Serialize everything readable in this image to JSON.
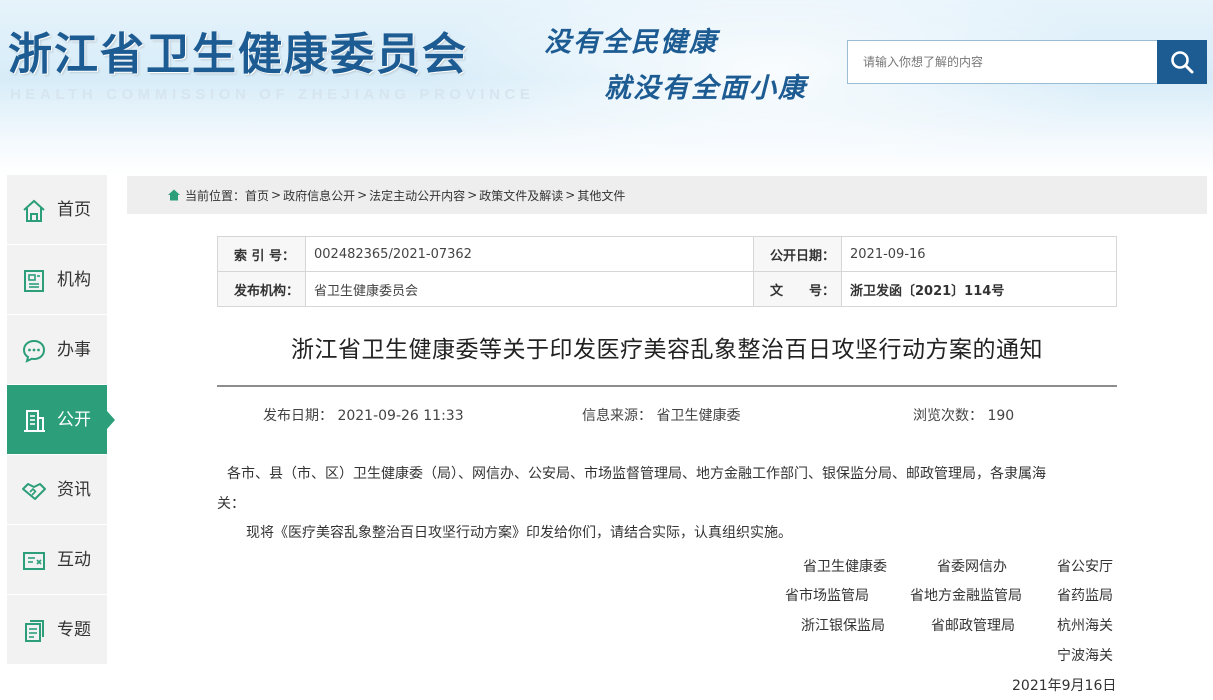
{
  "header": {
    "logo_cn": "浙江省卫生健康委员会",
    "logo_en": "HEALTH COMMISSION OF ZHEJIANG PROVINCE",
    "slogan_line1": "没有全民健康",
    "slogan_line2": "就没有全面小康",
    "search": {
      "placeholder": "请输入你想了解的内容",
      "button_icon": "search-icon"
    },
    "brand_color": "#1d5b93"
  },
  "sidebar": {
    "active_color": "#2c9f7a",
    "items": [
      {
        "label": "首页",
        "icon": "home-icon",
        "active": false
      },
      {
        "label": "机构",
        "icon": "building-card-icon",
        "active": false
      },
      {
        "label": "办事",
        "icon": "chat-dots-icon",
        "active": false
      },
      {
        "label": "公开",
        "icon": "office-building-icon",
        "active": true
      },
      {
        "label": "资讯",
        "icon": "handshake-icon",
        "active": false
      },
      {
        "label": "互动",
        "icon": "feedback-icon",
        "active": false
      },
      {
        "label": "专题",
        "icon": "document-stack-icon",
        "active": false
      }
    ]
  },
  "breadcrumb": {
    "prefix": "当前位置：",
    "items": [
      "首页",
      "政府信息公开",
      "法定主动公开内容",
      "政策文件及解读",
      "其他文件"
    ],
    "separator": ">"
  },
  "meta": {
    "index_label": "索 引 号：",
    "index_value": "002482365/2021-07362",
    "date_label": "公开日期：",
    "date_value": "2021-09-16",
    "org_label": "发布机构：",
    "org_value": "省卫生健康委员会",
    "docno_label": "文　　号：",
    "docno_value": "浙卫发函〔2021〕114号"
  },
  "article": {
    "title": "浙江省卫生健康委等关于印发医疗美容乱象整治百日攻坚行动方案的通知",
    "publish_label": "发布日期：",
    "publish_value": "2021-09-26 11:33",
    "source_label": "信息来源：",
    "source_value": "省卫生健康委",
    "views_label": "浏览次数：",
    "views_value": "190",
    "para1_line1": "各市、县（市、区）卫生健康委（局）、网信办、公安局、市场监督管理局、地方金融工作部门、银保监分局、邮政管理局，各隶属海",
    "para1_line2": "关：",
    "para2": "现将《医疗美容乱象整治百日攻坚行动方案》印发给你们，请结合实际，认真组织实施。",
    "signatories": [
      [
        "省卫生健康委",
        "省委网信办",
        "省公安厅"
      ],
      [
        "省市场监管局",
        "省地方金融监管局",
        "省药监局"
      ],
      [
        "浙江银保监局",
        "省邮政管理局",
        "杭州海关"
      ],
      [
        "宁波海关"
      ]
    ],
    "sign_date": "2021年9月16日"
  }
}
